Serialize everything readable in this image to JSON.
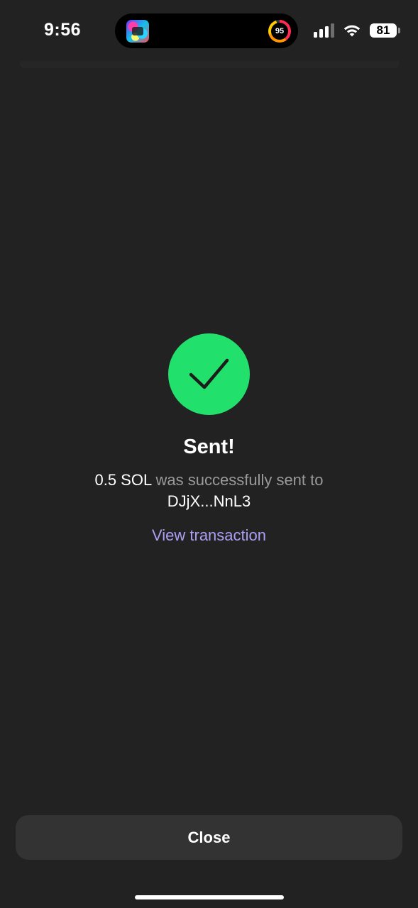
{
  "status_bar": {
    "time": "9:56",
    "activity_ring_value": "95",
    "battery_level": "81",
    "icons": [
      "signal-icon",
      "wifi-icon",
      "battery-icon"
    ]
  },
  "island": {
    "app_icon": "app-icon",
    "ring_icon": "activity-ring-icon"
  },
  "success": {
    "icon": "checkmark-icon",
    "icon_color": "#22e06c",
    "title": "Sent!",
    "amount": "0.5 SOL",
    "message_mid": " was successfully sent to ",
    "recipient": "DJjX...NnL3",
    "view_link": "View transaction",
    "link_color": "#ab9ff2"
  },
  "footer": {
    "close_label": "Close"
  },
  "colors": {
    "background": "#222222",
    "button_bg": "#333333",
    "muted_text": "#9a9a9a"
  }
}
